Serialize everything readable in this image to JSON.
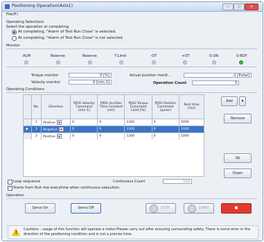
{
  "window": {
    "title": "Positioning Operation(Axis1)",
    "minimize": "—",
    "maximize": "▢",
    "close": "✕"
  },
  "menu": {
    "file": "File(F)"
  },
  "operating_selections": {
    "title": "Operating Selections",
    "prompt": "Select the operation at completing",
    "option1": "At completing, \"Alarm of Test Run Close\" is selected.",
    "option2": "At completing, \"Alarm of Test Run Close\" is not selected.",
    "selected": 1
  },
  "monitor": {
    "title": "Monitor",
    "signals": [
      {
        "label": "ALM",
        "on": false
      },
      {
        "label": "Reserve",
        "on": false
      },
      {
        "label": "Reserve",
        "on": false
      },
      {
        "label": "T-Limit",
        "on": false
      },
      {
        "label": "-OT",
        "on": false
      },
      {
        "label": "+OT",
        "on": false
      },
      {
        "label": "S-ON",
        "on": false
      },
      {
        "label": "S-RDY",
        "on": true
      }
    ],
    "torque_label": "Torque monitor",
    "torque_value": "0 [%]",
    "velocity_label": "Velocity monitor",
    "velocity_value": "0 [min-1]",
    "actual_pos_label": "Actual position monit...",
    "actual_pos_value": "-1 [Pulse]",
    "op_count_label": "Operation Count",
    "op_count_value": "3"
  },
  "conditions": {
    "title": "Operating Conditions",
    "headers": [
      "No.",
      "Direction",
      "PJOG Velocity Command [min-1]",
      "PJOG Acc/Dec Time Constant [ms]",
      "PJOG Torque Command Limit [%]",
      "PJOG Position Command [pulse]",
      "Rest time [ms]"
    ],
    "rows": [
      {
        "no": "1",
        "dir": "Positive",
        "vel": "0",
        "acc": "0",
        "torq": "1200",
        "pos": "0",
        "rest": "1000",
        "selected": false
      },
      {
        "no": "2",
        "dir": "Negative",
        "vel": "0",
        "acc": "0",
        "torq": "1200",
        "pos": "0",
        "rest": "1000",
        "selected": true
      },
      {
        "no": "3",
        "dir": "Positive",
        "vel": "0",
        "acc": "0",
        "torq": "1200",
        "pos": "0",
        "rest": "1000",
        "selected": false
      }
    ],
    "row_marker": "▶",
    "loop_label": "Loop sequence",
    "continuous_label": "Continuous Count",
    "continuous_value": "100",
    "start_first_label": "Starts from first row everytime when continuous execution.",
    "start_first_checked": true,
    "add_label": "Add",
    "remove_label": "Remove",
    "up_label": "Up",
    "down_label": "Down"
  },
  "operation": {
    "title": "Operation",
    "servo_on": "Servo On",
    "servo_off": "Servo Off",
    "stop": "STOP",
    "start": "START",
    "estop": "■"
  },
  "caution": "Cautions : usage of this function will operate a motor.Please carry out after ensuring surrounding safety. There is some error in the direction of the positioning condition and is not a precise time."
}
